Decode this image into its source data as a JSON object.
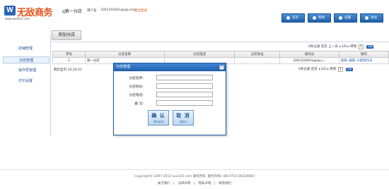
{
  "header": {
    "logo_badge": "W",
    "logo_text": "无敌商务",
    "logo_url": "www.wudi25.com",
    "store_name": "q第一分店",
    "user_label": "用户名:",
    "user_email": "3281354041@qq.com",
    "logout": "退出登录",
    "buttons": [
      {
        "label": "首页",
        "icon": "home-icon"
      },
      {
        "label": "帮助",
        "icon": "help-icon"
      },
      {
        "label": "设置",
        "icon": "settings-icon"
      },
      {
        "label": "退出",
        "icon": "exit-icon"
      }
    ]
  },
  "sidebar": {
    "items": [
      {
        "label": "店铺管理",
        "active": false
      },
      {
        "label": "分店管理",
        "active": true
      },
      {
        "label": "操作员管理",
        "active": false
      },
      {
        "label": "打印设置",
        "active": false
      }
    ]
  },
  "main": {
    "add_button": "添加分店",
    "pager_top": {
      "text": "0条记录 首页 上一页 ◂ 1/0 ▸ 转到",
      "page": "1",
      "go": "Go"
    },
    "table": {
      "columns": [
        "序号",
        "分店名称",
        "分店电话",
        "分店地址",
        "操作员",
        "操作"
      ],
      "rows": [
        {
          "index": "1",
          "name": "第一分店",
          "phone": "",
          "address": "",
          "operator": "3281354041@qq.c...",
          "ops": [
            "删除",
            "编辑",
            "分配操作员"
          ]
        }
      ]
    },
    "footer_left": "网页显示:10:20:41",
    "pager_bottom": {
      "text": "0条记录 首页 ◂ 1/0 ▸ 转到",
      "page": "1",
      "go": "Go"
    }
  },
  "dialog": {
    "title": "分店管理",
    "close": "×",
    "fields": [
      {
        "label": "分店名称:",
        "value": ""
      },
      {
        "label": "分店地址:",
        "value": ""
      },
      {
        "label": "分店电话:",
        "value": ""
      },
      {
        "label": "备    注:",
        "value": ""
      }
    ],
    "confirm": {
      "label": "确 认",
      "sub": "[Enter]"
    },
    "cancel": {
      "label": "取 消",
      "sub": "[Esc]"
    }
  },
  "footer": {
    "copyright": "Copyright© 2007-2013 wudi25.com 版权所有, 服务热线:+86 0755-86329883",
    "links": [
      "关于我们",
      "法律声明",
      "隐私声明",
      "联系我们"
    ]
  }
}
